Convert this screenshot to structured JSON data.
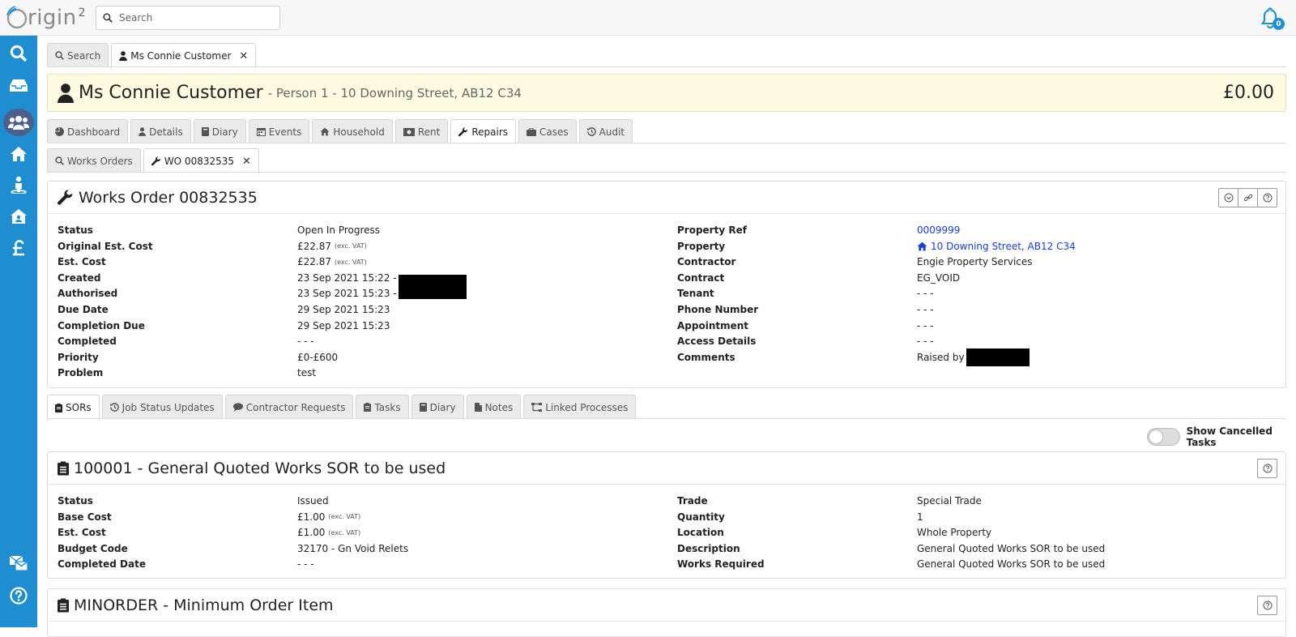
{
  "app": {
    "logo_text": "rigin",
    "logo_sup": "2"
  },
  "search": {
    "placeholder": "Search"
  },
  "notifications": {
    "count": "0"
  },
  "sidebar": {
    "items": [
      {
        "name": "search"
      },
      {
        "name": "inbox"
      },
      {
        "name": "people"
      },
      {
        "name": "home"
      },
      {
        "name": "person"
      },
      {
        "name": "property"
      },
      {
        "name": "finance"
      },
      {
        "name": "messages"
      },
      {
        "name": "help"
      }
    ]
  },
  "top_tabs": [
    {
      "label": "Search"
    },
    {
      "label": "Ms Connie Customer",
      "closable": true
    }
  ],
  "customer": {
    "name": "Ms Connie Customer",
    "subtitle": "- Person 1 - 10 Downing Street, AB12 C34",
    "balance": "£0.00"
  },
  "customer_tabs": [
    {
      "label": "Dashboard"
    },
    {
      "label": "Details"
    },
    {
      "label": "Diary"
    },
    {
      "label": "Events"
    },
    {
      "label": "Household"
    },
    {
      "label": "Rent"
    },
    {
      "label": "Repairs"
    },
    {
      "label": "Cases"
    },
    {
      "label": "Audit"
    }
  ],
  "repair_tabs": [
    {
      "label": "Works Orders"
    },
    {
      "label": "WO 00832535",
      "closable": true
    }
  ],
  "works_order": {
    "title": "Works Order 00832535",
    "left": [
      {
        "label": "Status",
        "value": "Open In Progress"
      },
      {
        "label": "Original Est. Cost",
        "value": "£22.87",
        "vat": "(exc. VAT)"
      },
      {
        "label": "Est. Cost",
        "value": "£22.87",
        "vat": "(exc. VAT)"
      },
      {
        "label": "Created",
        "value": "23 Sep 2021 15:22 -"
      },
      {
        "label": "Authorised",
        "value": "23 Sep 2021 15:23 -"
      },
      {
        "label": "Due Date",
        "value": "29 Sep 2021 15:23"
      },
      {
        "label": "Completion Due",
        "value": "29 Sep 2021 15:23"
      },
      {
        "label": "Completed",
        "value": "- - -"
      },
      {
        "label": "Priority",
        "value": "£0-£600"
      },
      {
        "label": "Problem",
        "value": "test"
      }
    ],
    "right": [
      {
        "label": "Property Ref",
        "value": "0009999"
      },
      {
        "label": "Property",
        "value": "10 Downing Street, AB12 C34"
      },
      {
        "label": "Contractor",
        "value": "Engie Property Services"
      },
      {
        "label": "Contract",
        "value": "EG_VOID"
      },
      {
        "label": "Tenant",
        "value": "- - -"
      },
      {
        "label": "Phone Number",
        "value": "- - -"
      },
      {
        "label": "Appointment",
        "value": "- - -"
      },
      {
        "label": "Access Details",
        "value": "- - -"
      },
      {
        "label": "Comments",
        "value": "Raised by"
      }
    ]
  },
  "wo_tabs": [
    {
      "label": "SORs"
    },
    {
      "label": "Job Status Updates"
    },
    {
      "label": "Contractor Requests"
    },
    {
      "label": "Tasks"
    },
    {
      "label": "Diary"
    },
    {
      "label": "Notes"
    },
    {
      "label": "Linked Processes"
    }
  ],
  "toggle": {
    "label": "Show Cancelled Tasks",
    "on": false
  },
  "sor1": {
    "title": "100001 - General Quoted Works SOR to be used",
    "left": [
      {
        "label": "Status",
        "value": "Issued"
      },
      {
        "label": "Base Cost",
        "value": "£1.00",
        "vat": "(exc. VAT)"
      },
      {
        "label": "Est. Cost",
        "value": "£1.00",
        "vat": "(exc. VAT)"
      },
      {
        "label": "Budget Code",
        "value": "32170 - Gn Void Relets"
      },
      {
        "label": "Completed Date",
        "value": "- - -"
      }
    ],
    "right": [
      {
        "label": "Trade",
        "value": "Special Trade"
      },
      {
        "label": "Quantity",
        "value": "1"
      },
      {
        "label": "Location",
        "value": "Whole Property"
      },
      {
        "label": "Description",
        "value": "General Quoted Works SOR to be used"
      },
      {
        "label": "Works Required",
        "value": "General Quoted Works SOR to be used"
      }
    ]
  },
  "sor2": {
    "title": "MINORDER - Minimum Order Item"
  },
  "colors": {
    "sidebar": "#1f8ed0",
    "banner": "#fdfbe1",
    "link": "#1a3fd6",
    "badge": "#1e8fd5"
  }
}
